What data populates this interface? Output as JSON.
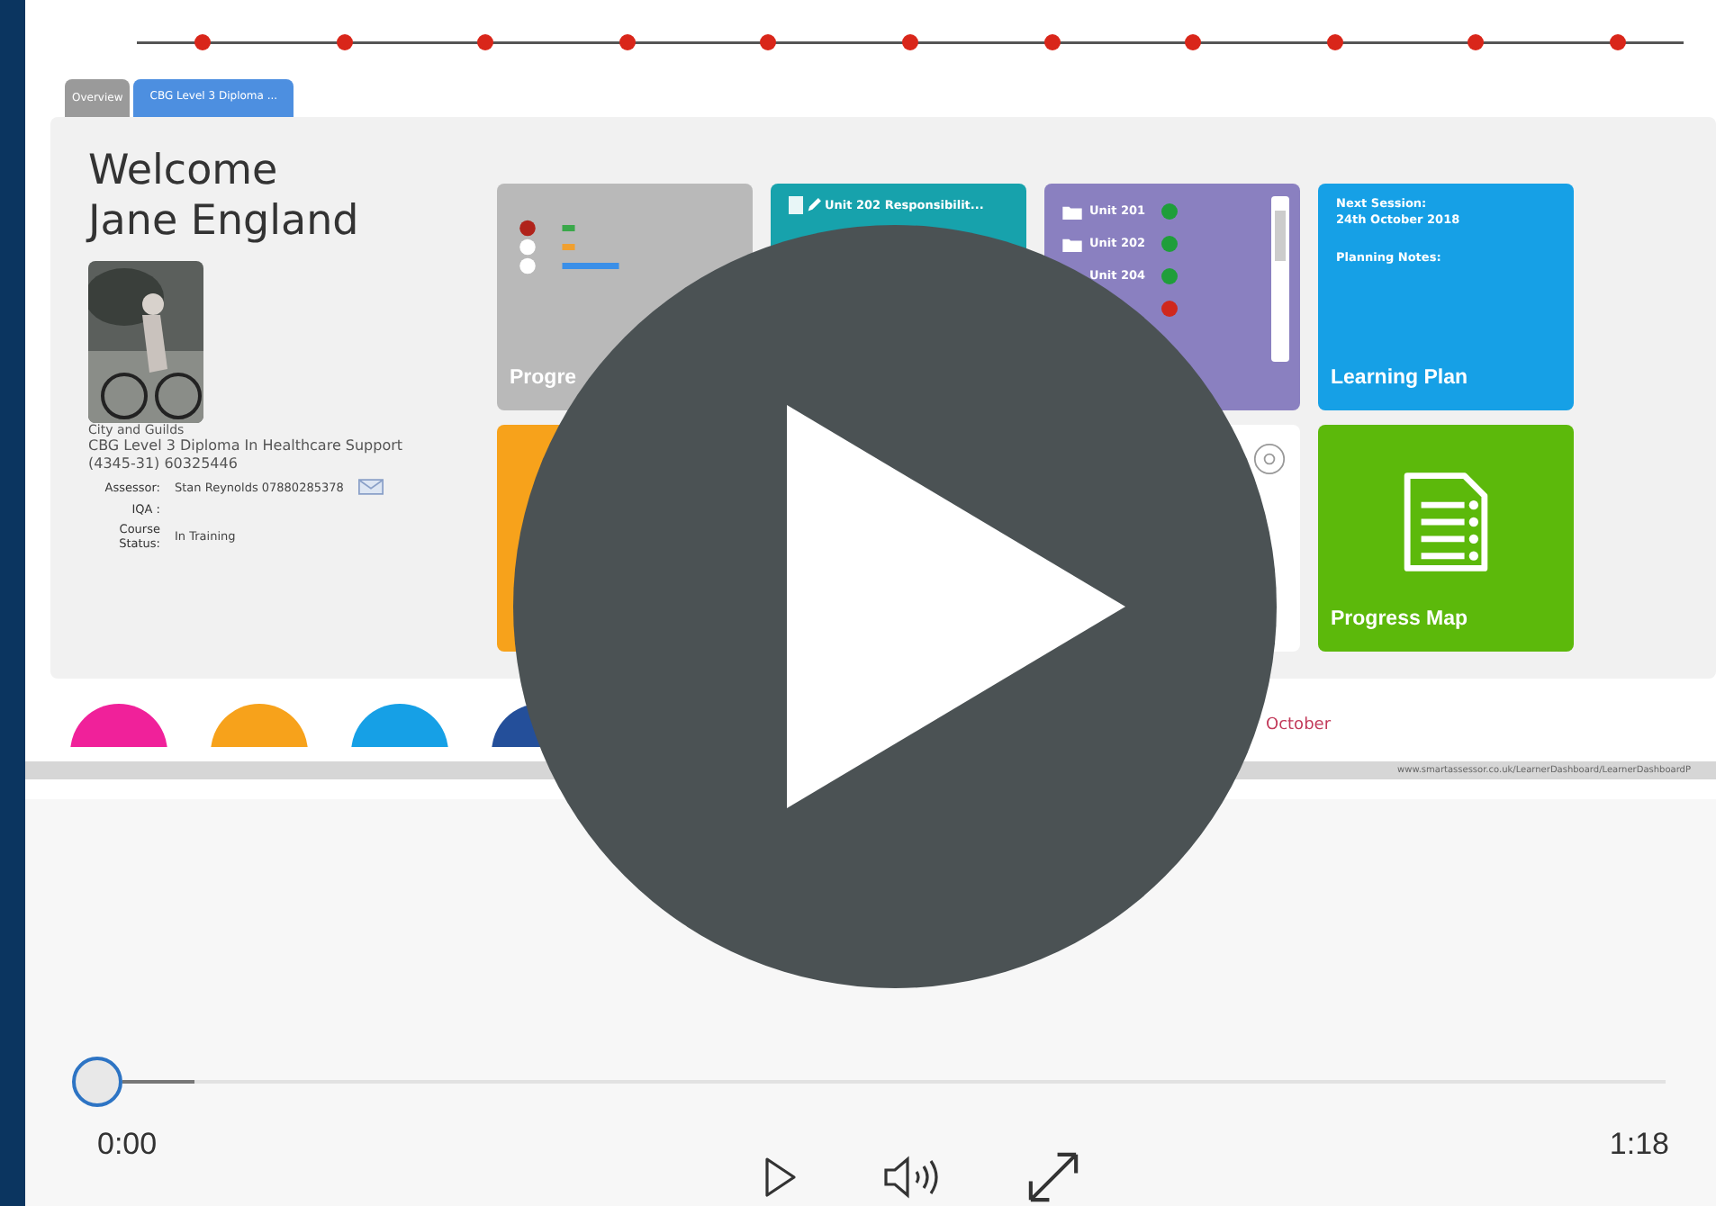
{
  "tabs": [
    {
      "label": "Overview",
      "selected": false
    },
    {
      "label": "CBG Level 3 Diploma ...",
      "selected": true
    }
  ],
  "profile": {
    "welcome": "Welcome",
    "name": "Jane England",
    "awarding_body": "City and Guilds",
    "qualification": "CBG Level 3 Diploma In Healthcare Support (4345-31) 60325446",
    "fields": [
      {
        "label": "Assessor:",
        "value": "Stan Reynolds 07880285378"
      },
      {
        "label": "IQA :"
      },
      {
        "label": "Course Status:",
        "value": "In Training"
      }
    ]
  },
  "tiles": [
    {
      "kind": "progress",
      "color": "#b9b9b9",
      "title": "Progre"
    },
    {
      "kind": "unit",
      "color": "#17a2ac",
      "title": "Unit 202 Responsibilit..."
    },
    {
      "kind": "units",
      "color": "#8a80c0",
      "units": [
        {
          "label": "Unit 201",
          "color": "#1f9e3a"
        },
        {
          "label": "Unit 202",
          "color": "#1f9e3a"
        },
        {
          "label": "Unit 204",
          "color": "#1f9e3a"
        },
        {
          "color": "#d0281d"
        }
      ]
    },
    {
      "kind": "plan",
      "color": "#16a0e6",
      "lines": [
        "Next Session:",
        "24th October 2018",
        "Planning Notes:"
      ],
      "title": "Learning Plan"
    },
    {
      "kind": "blank",
      "color": "#f7a21b"
    },
    {
      "kind": "clock",
      "color": "#ffffff"
    },
    {
      "kind": "map",
      "color": "#5cb90b",
      "title": "Progress Map"
    }
  ],
  "bubbles": [
    {
      "color": "#f0219a"
    },
    {
      "color": "#f7a21b"
    },
    {
      "color": "#16a0e6"
    },
    {
      "color": "#244f9a"
    }
  ],
  "event_date": "October",
  "status_url": "www.smartassessor.co.uk/LearnerDashboard/LearnerDashboardP",
  "player": {
    "level": 0,
    "time": "0:00",
    "duration": "1:18"
  }
}
